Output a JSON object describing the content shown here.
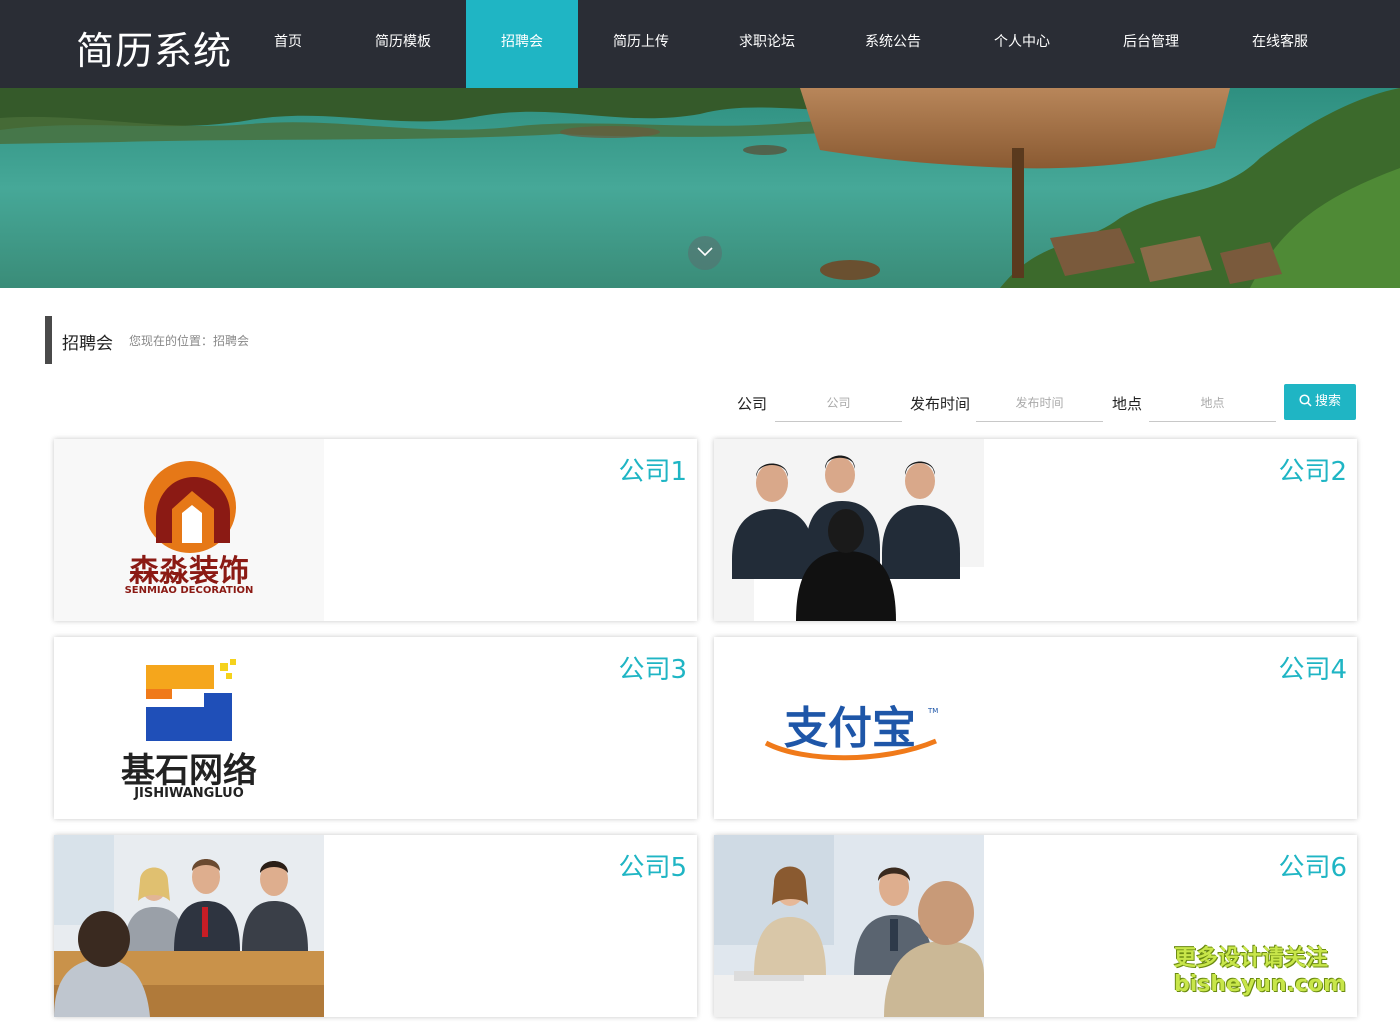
{
  "header": {
    "logo": "简历系统",
    "nav": [
      {
        "label": "首页",
        "active": false
      },
      {
        "label": "简历模板",
        "active": false
      },
      {
        "label": "招聘会",
        "active": true
      },
      {
        "label": "简历上传",
        "active": false
      },
      {
        "label": "求职论坛",
        "active": false
      },
      {
        "label": "系统公告",
        "active": false
      },
      {
        "label": "个人中心",
        "active": false
      },
      {
        "label": "后台管理",
        "active": false
      },
      {
        "label": "在线客服",
        "active": false
      }
    ]
  },
  "section": {
    "title": "招聘会",
    "breadcrumb": "您现在的位置：招聘会"
  },
  "search": {
    "company_label": "公司",
    "company_placeholder": "公司",
    "time_label": "发布时间",
    "time_placeholder": "发布时间",
    "location_label": "地点",
    "location_placeholder": "地点",
    "button_label": "搜索"
  },
  "cards": [
    {
      "name": "公司1",
      "logo_text": "森淼装饰",
      "logo_sub": "SENMIAO DECORATION"
    },
    {
      "name": "公司2"
    },
    {
      "name": "公司3",
      "logo_text": "基石网络",
      "logo_sub": "JISHIWANGLUO"
    },
    {
      "name": "公司4",
      "logo_text": "支付宝"
    },
    {
      "name": "公司5"
    },
    {
      "name": "公司6"
    }
  ],
  "watermark": {
    "line1": "更多设计请关注",
    "line2": "bisheyun.com"
  },
  "colors": {
    "accent": "#1fb5c4",
    "header_bg": "#2a2d35"
  }
}
